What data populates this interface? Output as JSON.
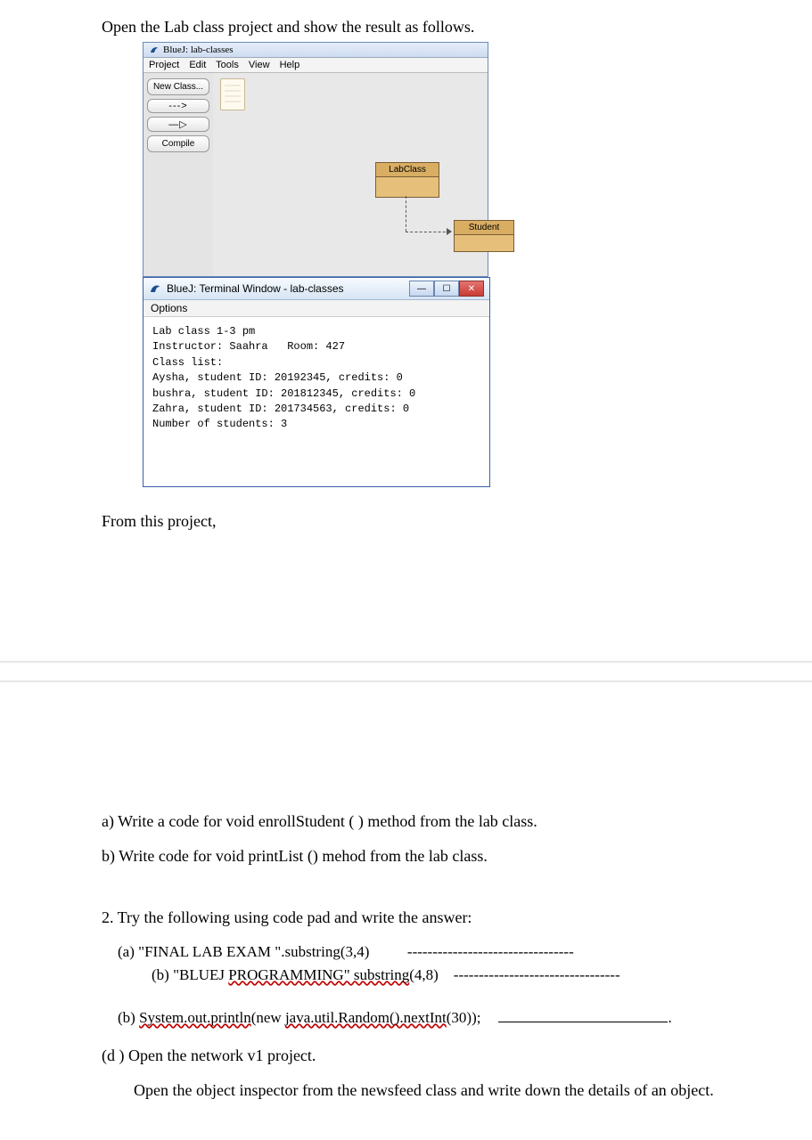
{
  "intro": "Open the Lab class project and show the result as follows.",
  "bluej_main": {
    "title": "BlueJ: lab-classes",
    "menu": [
      "Project",
      "Edit",
      "Tools",
      "View",
      "Help"
    ],
    "buttons": {
      "new_class": "New Class...",
      "arrow1": "--->",
      "arrow2": "—▷",
      "compile": "Compile"
    },
    "classes": {
      "lab": "LabClass",
      "student": "Student"
    }
  },
  "terminal": {
    "title": "BlueJ: Terminal Window - lab-classes",
    "options": "Options",
    "lines": [
      "Lab class 1-3 pm",
      "Instructor: Saahra   Room: 427",
      "Class list:",
      "Aysha, student ID: 20192345, credits: 0",
      "bushra, student ID: 201812345, credits: 0",
      "Zahra, student ID: 201734563, credits: 0",
      "Number of students: 3"
    ]
  },
  "after": "From this project,",
  "qa": {
    "a": "a)  Write a code for void enrollStudent ( ) method  from the lab class.",
    "b": "b)  Write code for void printList () mehod from the lab class."
  },
  "q2": {
    "intro": "2.  Try the following using code pad and write the answer:",
    "sub_a_label": "(a)  ",
    "sub_a_text": "\"FINAL LAB EXAM \".substring(3,4)",
    "dashes": "---------------------------------",
    "sub_ab_label": "(b) ",
    "sub_ab_prefix": "\"BLUEJ ",
    "sub_ab_squiggle": "PROGRAMMING\" substring",
    "sub_ab_suffix": "(4,8)",
    "sub_b_label": "(b)  ",
    "sub_b_sq1": "System.out.println",
    "sub_b_mid": "(new ",
    "sub_b_sq2": "java.util.Random().nextInt",
    "sub_b_end": "(30));",
    "sub_d": "(d ) Open the network v1 project.",
    "sub_d_detail": "Open the object inspector from the newsfeed class and write down the details of an object."
  }
}
